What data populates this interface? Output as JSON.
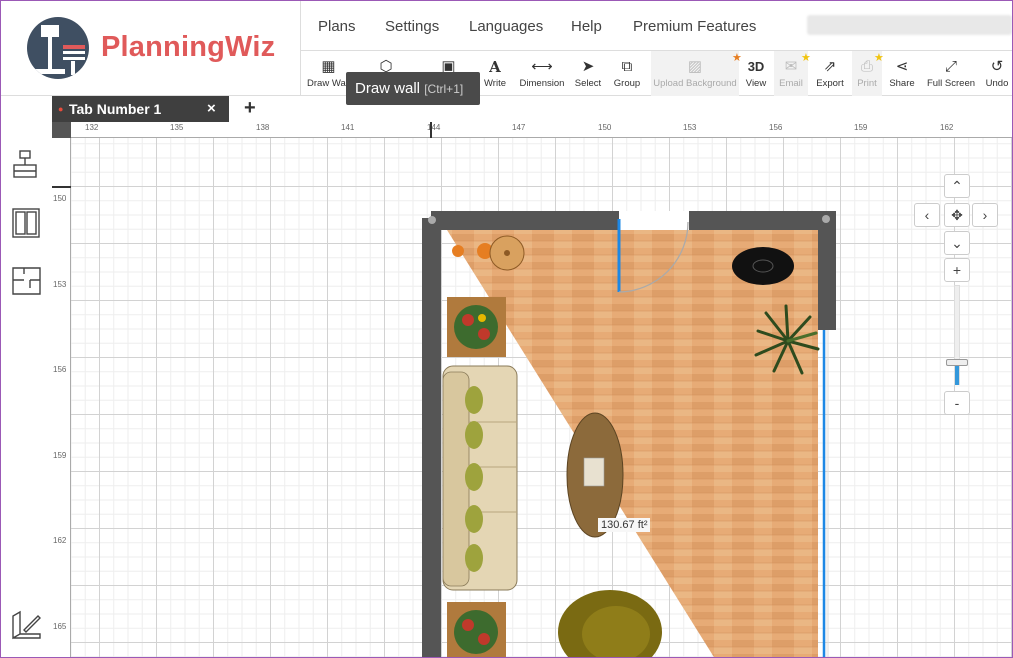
{
  "app": {
    "logo_text": "PlanningWiz"
  },
  "menu": [
    {
      "label": "Plans"
    },
    {
      "label": "Settings"
    },
    {
      "label": "Languages"
    },
    {
      "label": "Help"
    },
    {
      "label": "Premium Features"
    }
  ],
  "toolbar": {
    "draw_wall": "Draw Wall",
    "write": "Write",
    "dimension": "Dimension",
    "select": "Select",
    "group": "Group",
    "upload_background": "Upload Background",
    "view_3d_icon_text": "3D",
    "view": "View",
    "email": "Email",
    "export": "Export",
    "print": "Print",
    "share": "Share",
    "full_screen": "Full Screen",
    "undo": "Undo"
  },
  "tooltip": {
    "title": "Draw wall",
    "shortcut": "[Ctrl+1]"
  },
  "tabs": {
    "active_label": "Tab Number 1",
    "close_symbol": "×",
    "add_symbol": "+"
  },
  "ruler": {
    "top_ticks": [
      "132",
      "135",
      "138",
      "141",
      "144",
      "147",
      "150",
      "153",
      "156",
      "159",
      "162"
    ],
    "left_ticks": [
      "150",
      "153",
      "156",
      "159",
      "162",
      "165"
    ]
  },
  "plan": {
    "area_label": "130.67 ft²"
  },
  "nav": {
    "up": "⌃",
    "left": "‹",
    "center": "✥",
    "right": "›",
    "down": "⌄",
    "zoom_in": "+",
    "zoom_out": "-",
    "zoom_level": 0.2
  },
  "colors": {
    "accent": "#e05a5a",
    "logo_dark": "#3f4f62",
    "wall": "#555555",
    "floor": "#e3a26d",
    "door": "#1e88e5"
  },
  "icons": [
    "draw-wall-icon",
    "cube-icon",
    "text-icon",
    "dimension-icon",
    "cursor-icon",
    "group-icon",
    "image-icon",
    "email-icon",
    "export-icon",
    "print-icon",
    "share-icon",
    "fullscreen-icon",
    "undo-icon"
  ]
}
